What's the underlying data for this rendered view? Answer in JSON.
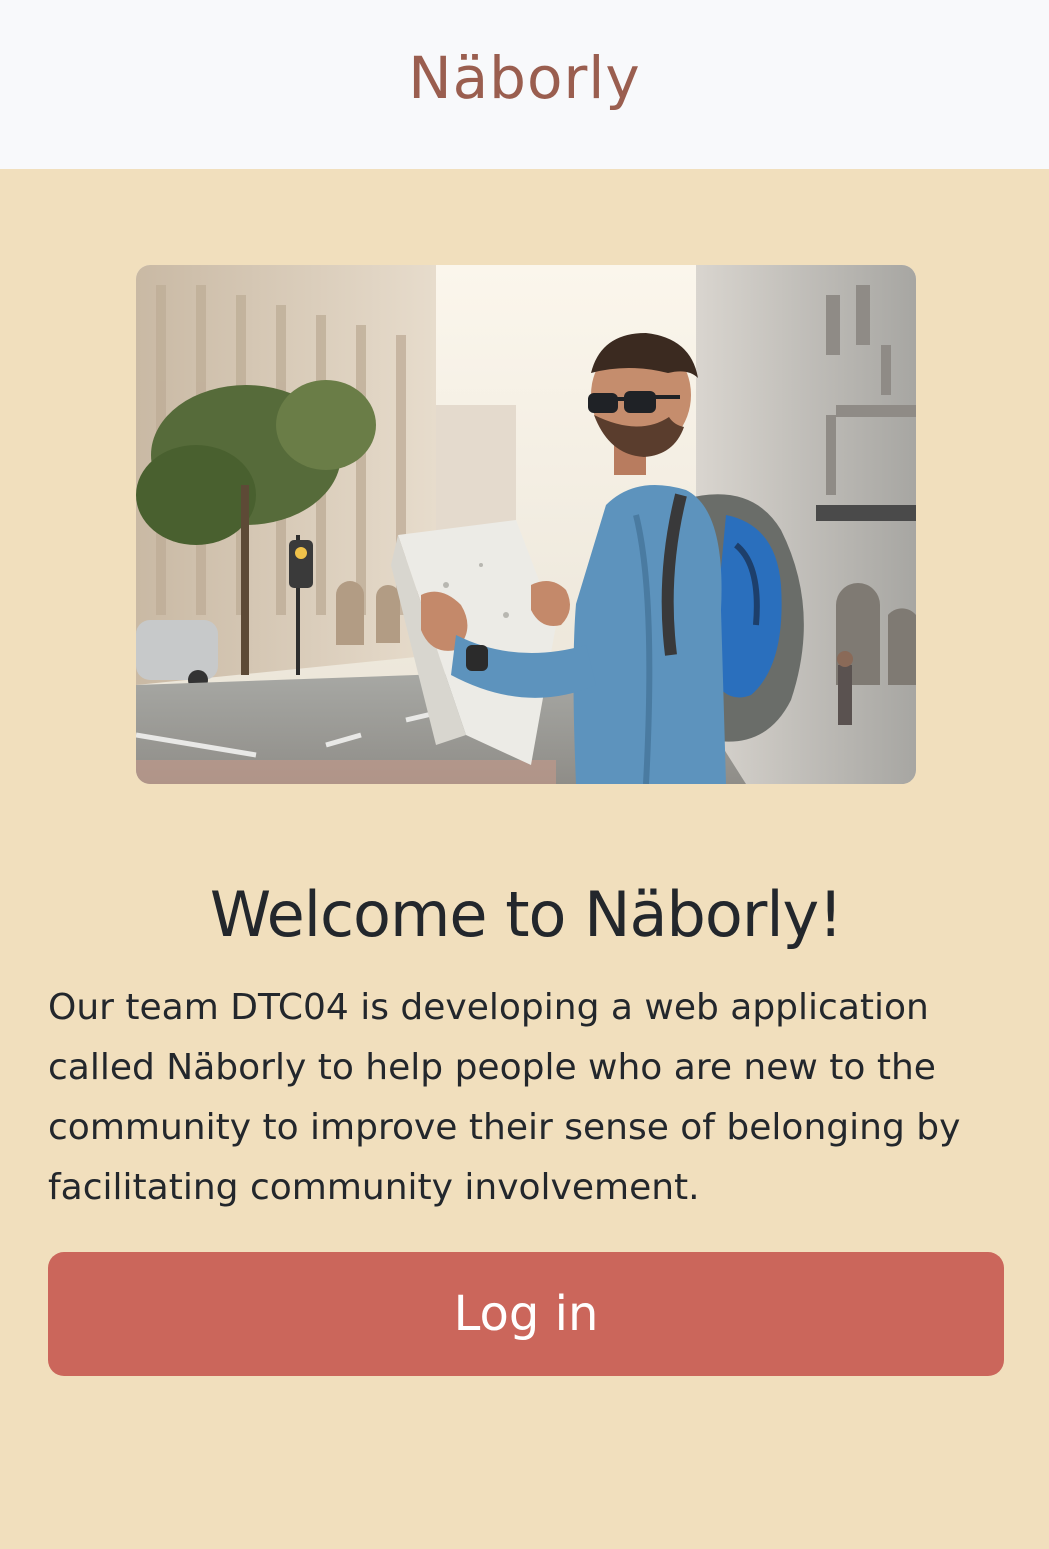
{
  "header": {
    "brand": "Näborly"
  },
  "hero": {
    "image_name": "traveler-with-map-photo"
  },
  "main": {
    "title": "Welcome to Näborly!",
    "description": "Our team DTC04 is developing a web application called Näborly to help people who are new to the community to improve their sense of belonging by facilitating community involvement.",
    "login_label": "Log in"
  },
  "colors": {
    "background": "#f1dfbd",
    "header_bg": "#f8f9fb",
    "brand": "#9a5e4f",
    "button": "#cb665b",
    "text": "#23272c"
  }
}
